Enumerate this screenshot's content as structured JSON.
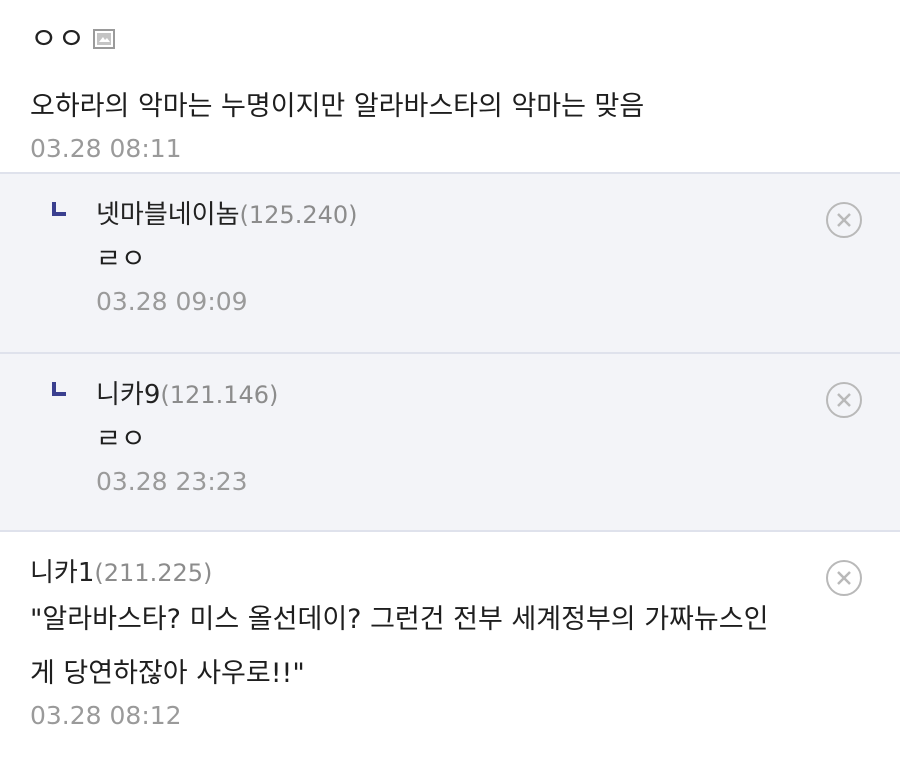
{
  "comments": [
    {
      "nick": "ㅇㅇ",
      "ip": "",
      "text": "오하라의 악마는 누명이지만 알라바스타의 악마는 맞음",
      "time": "03.28 08:11"
    },
    {
      "nick": "넷마블네이놈",
      "ip": "(125.240)",
      "text": "ㄹㅇ",
      "time": "03.28 09:09"
    },
    {
      "nick": "니카9",
      "ip": "(121.146)",
      "text": "ㄹㅇ",
      "time": "03.28 23:23"
    },
    {
      "nick": "니카1",
      "ip": "(211.225)",
      "text_line1": "\"알라바스타? 미스 올선데이? 그런건 전부 세계정부의 가짜뉴스인",
      "text_line2": "게 당연하잖아 사우로!!\"",
      "time": "03.28 08:12"
    }
  ],
  "icons": {
    "reply": "reply-arrow-icon",
    "delete": "delete-circle-icon",
    "image": "image-icon"
  },
  "colors": {
    "reply_bg": "#f3f4f8",
    "reply_arrow": "#3a3f8f",
    "timestamp": "#9a9a9a"
  }
}
